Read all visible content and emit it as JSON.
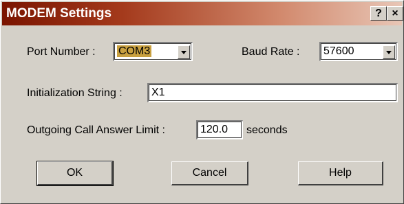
{
  "window": {
    "title": "MODEM Settings",
    "help_glyph": "?",
    "close_glyph": "×"
  },
  "port": {
    "label": "Port Number :",
    "value": "COM3",
    "highlight_color": "#c8a040"
  },
  "baud": {
    "label": "Baud Rate :",
    "value": "57600"
  },
  "init": {
    "label": "Initialization String :",
    "value": "X1"
  },
  "limit": {
    "label": "Outgoing Call Answer Limit :",
    "value": "120.0",
    "unit": "seconds"
  },
  "buttons": {
    "ok": "OK",
    "cancel": "Cancel",
    "help": "Help"
  }
}
